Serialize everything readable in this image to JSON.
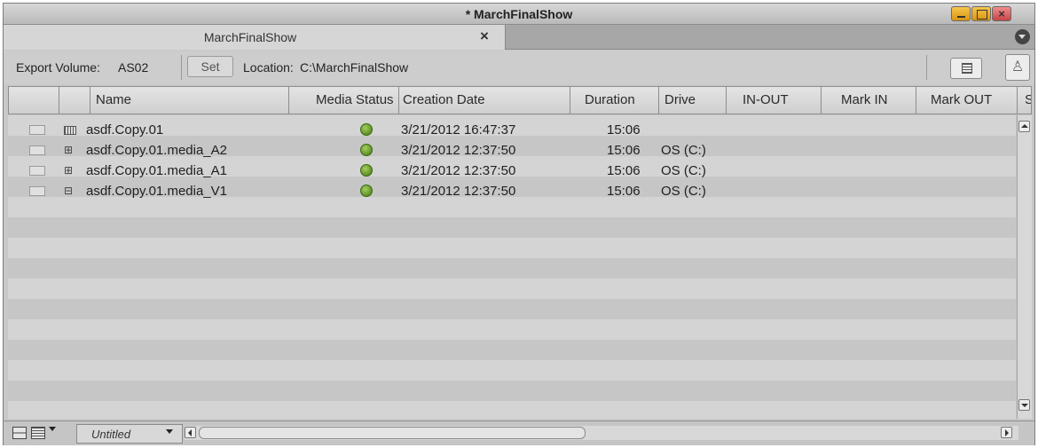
{
  "window": {
    "title": "* MarchFinalShow"
  },
  "tab": {
    "label": "MarchFinalShow",
    "close_glyph": "×"
  },
  "info": {
    "export_volume_label": "Export Volume:",
    "export_volume_value": "AS02",
    "set_button_label": "Set",
    "location_label": "Location:",
    "location_value": "C:\\MarchFinalShow"
  },
  "columns": [
    "Name",
    "Media Status",
    "Creation Date",
    "Duration",
    "Drive",
    "IN-OUT",
    "Mark IN",
    "Mark OUT",
    "St"
  ],
  "rows": [
    {
      "icon": "sequence-icon",
      "name": "asdf.Copy.01",
      "status": "online",
      "creation_date": "3/21/2012 16:47:37",
      "duration": "15:06",
      "drive": ""
    },
    {
      "icon": "audio-clip-icon",
      "name": "asdf.Copy.01.media_A2",
      "status": "online",
      "creation_date": "3/21/2012 12:37:50",
      "duration": "15:06",
      "drive": "OS (C:)"
    },
    {
      "icon": "audio-clip-icon",
      "name": "asdf.Copy.01.media_A1",
      "status": "online",
      "creation_date": "3/21/2012 12:37:50",
      "duration": "15:06",
      "drive": "OS (C:)"
    },
    {
      "icon": "video-clip-icon",
      "name": "asdf.Copy.01.media_V1",
      "status": "online",
      "creation_date": "3/21/2012 12:37:50",
      "duration": "15:06",
      "drive": "OS (C:)"
    }
  ],
  "bottom": {
    "view_name": "Untitled"
  },
  "colors": {
    "status_online": "#6a9a2e",
    "title_close": "#c84444",
    "title_min_max": "#e0a020"
  }
}
